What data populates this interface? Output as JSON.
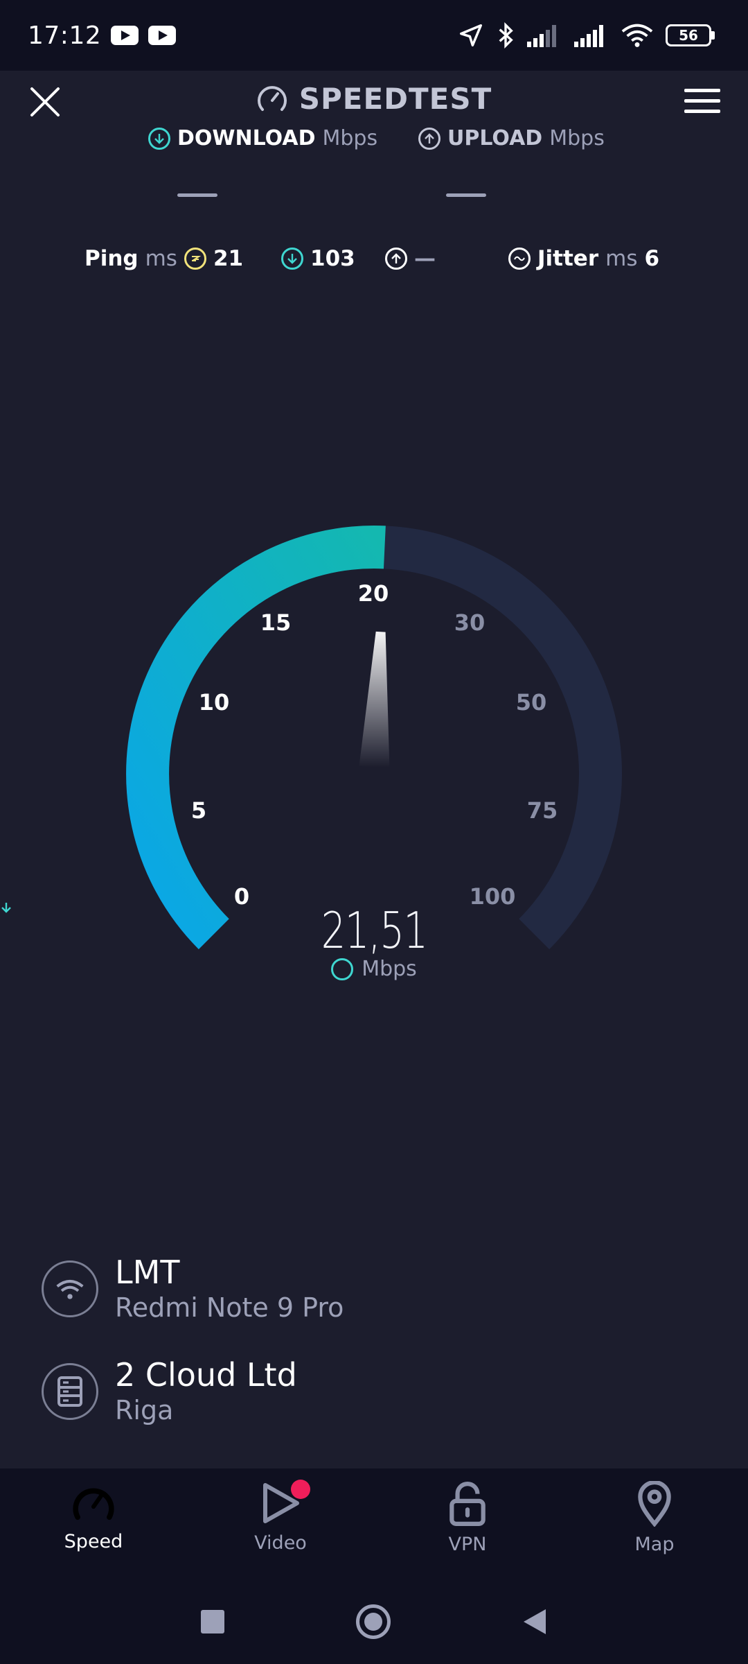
{
  "status_bar": {
    "time": "17:12",
    "battery": "56"
  },
  "header": {
    "title": "SPEEDTEST"
  },
  "tests": {
    "download": {
      "label": "DOWNLOAD",
      "unit": "Mbps",
      "value": "—"
    },
    "upload": {
      "label": "UPLOAD",
      "unit": "Mbps",
      "value": "—"
    }
  },
  "metrics": {
    "ping": {
      "label": "Ping",
      "unit": "ms",
      "value": "21"
    },
    "download_latency": {
      "value": "103"
    },
    "upload_latency": {
      "value": "—"
    },
    "jitter": {
      "label": "Jitter",
      "unit": "ms",
      "value": "6"
    }
  },
  "gauge": {
    "ticks": [
      "0",
      "5",
      "10",
      "15",
      "20",
      "30",
      "50",
      "75",
      "100"
    ],
    "reading": "21,51",
    "unit": "Mbps",
    "progress_fraction": 0.51
  },
  "connection": {
    "provider": "LMT",
    "device": "Redmi Note 9 Pro",
    "server": "2 Cloud Ltd",
    "server_location": "Riga"
  },
  "nav": {
    "speed": "Speed",
    "video": "Video",
    "vpn": "VPN",
    "map": "Map"
  },
  "colors": {
    "background": "#1c1d2d",
    "accent_teal": "#14b8b0",
    "accent_blue": "#0aa6e8",
    "notification": "#ef1e5a"
  }
}
